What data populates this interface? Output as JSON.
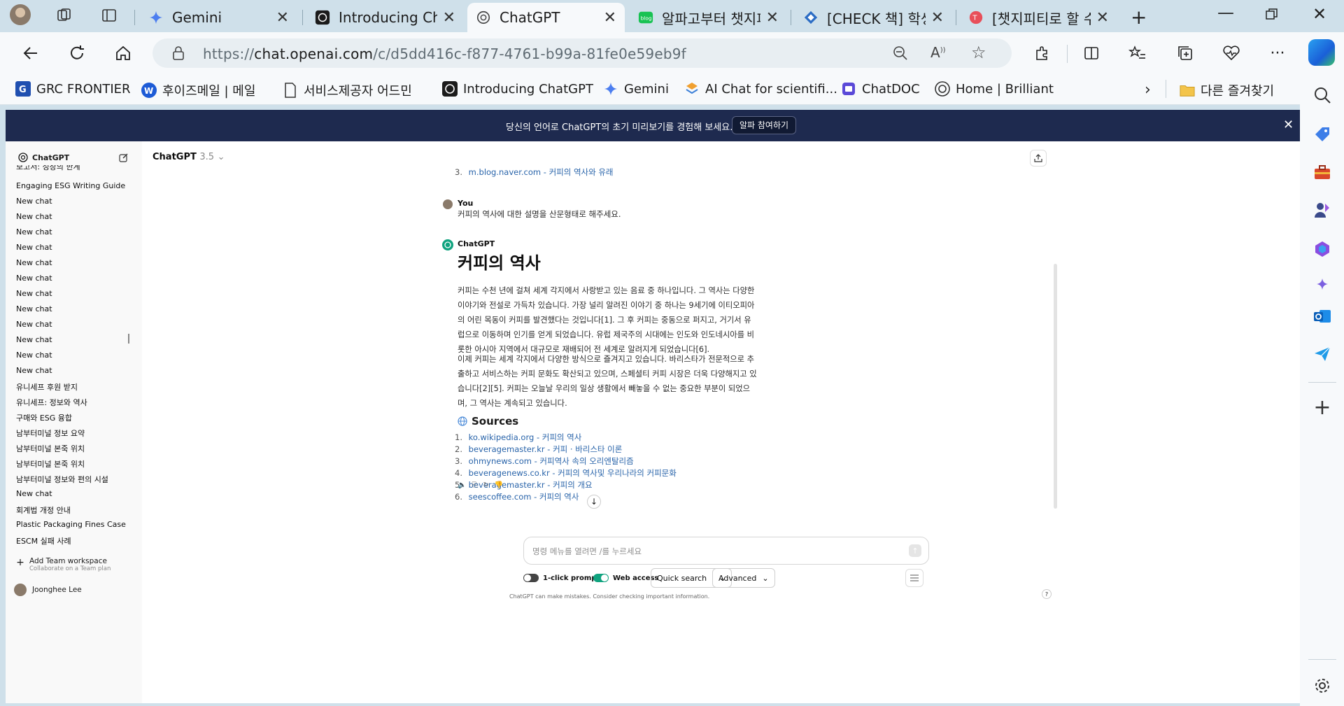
{
  "browser": {
    "tabs": [
      {
        "label": "Gemini",
        "active": false
      },
      {
        "label": "Introducing ChatGPT",
        "active": false
      },
      {
        "label": "ChatGPT",
        "active": true
      },
      {
        "label": "알파고부터 챗지피",
        "active": false
      },
      {
        "label": "[CHECK 책] 학생들",
        "active": false
      },
      {
        "label": "[챗지피티로 할 수",
        "active": false
      }
    ],
    "url_prefix": "https://",
    "url_host": "chat.openai.com",
    "url_path": "/c/d5dd416c-f877-4761-b99a-81fe0e59eb9f",
    "bookmarks": [
      {
        "label": "GRC FRONTIER",
        "icon": "grc-logo-icon"
      },
      {
        "label": "후이즈메일 | 메일",
        "icon": "whois-logo-icon"
      },
      {
        "label": "서비스제공자 어드민",
        "icon": "document-icon"
      },
      {
        "label": "Introducing ChatGPT",
        "icon": "chatgpt-logo-icon"
      },
      {
        "label": "Gemini",
        "icon": "gemini-icon"
      },
      {
        "label": "AI Chat for scientifi...",
        "icon": "scite-icon"
      },
      {
        "label": "ChatDOC",
        "icon": "chatdoc-icon"
      },
      {
        "label": "Home | Brilliant",
        "icon": "brilliant-icon"
      }
    ],
    "other_bookmarks": "다른 즐겨찾기"
  },
  "banner": {
    "text": "당신의 언어로 ChatGPT의 초기 미리보기를 경험해 보세요.",
    "button": "알파 참여하기"
  },
  "sidebar": {
    "title": "ChatGPT",
    "items": [
      "보고서: 성장의 한계",
      "Engaging ESG Writing Guide",
      "New chat",
      "New chat",
      "New chat",
      "New chat",
      "New chat",
      "New chat",
      "New chat",
      "New chat",
      "New chat",
      "New chat",
      "New chat",
      "New chat",
      "유니세프 후원 받지",
      "유니세프: 정보와 역사",
      "구매와 ESG 융합",
      "남부터미널 정보 요약",
      "남부터미널 본죽 위치",
      "남부터미널 본죽 위치",
      "남부터미널 정보와 편의 시설",
      "New chat",
      "회계법 개정 안내",
      "Plastic Packaging Fines Case",
      "ESCM 실패 사례"
    ],
    "team_title": "Add Team workspace",
    "team_sub": "Collaborate on a Team plan",
    "user": "Joonghee Lee"
  },
  "chat": {
    "model": "ChatGPT",
    "model_version": "3.5",
    "prev_source_num": "3.",
    "prev_source": "m.blog.naver.com - 커피의 역사와 유래",
    "user_name": "You",
    "user_msg": "커피의 역사에 대한 설명을 산문형태로 해주세요.",
    "bot_name": "ChatGPT",
    "heading": "커피의 역사",
    "para1": "커피는 수천 년에 걸쳐 세계 각지에서 사랑받고 있는 음료 중 하나입니다. 그 역사는 다양한 이야기와 전설로 가득차 있습니다. 가장 널리 알려진 이야기 중 하나는 9세기에 이티오피아의 어린 목동이 커피를 발견했다는 것입니다[1]. 그 후 커피는 중동으로 퍼지고, 거기서 유럽으로 이동하며 인기를 얻게 되었습니다. 유럽 제국주의 시대에는 인도와 인도네시아를 비롯한 아시아 지역에서 대규모로 재배되어 전 세계로 알려지게 되었습니다[6].",
    "para2": "이제 커피는 세계 각지에서 다양한 방식으로 즐겨지고 있습니다. 바리스타가 전문적으로 추출하고 서비스하는 커피 문화도 확산되고 있으며, 스페셜티 커피 시장은 더욱 다양해지고 있습니다[2][5]. 커피는 오늘날 우리의 일상 생활에서 빼놓을 수 없는 중요한 부분이 되었으며, 그 역사는 계속되고 있습니다.",
    "sources_title": "Sources",
    "sources": [
      {
        "num": "1.",
        "text": "ko.wikipedia.org - 커피의 역사"
      },
      {
        "num": "2.",
        "text": "beveragemaster.kr - 커피 · 바리스타 이론"
      },
      {
        "num": "3.",
        "text": "ohmynews.com - 커피역사 속의 오리엔탈리즘"
      },
      {
        "num": "4.",
        "text": "beveragenews.co.kr - 커피의 역사및 우리나라의 커피문화"
      },
      {
        "num": "5.",
        "text": "beveragemaster.kr - 커피의 개요"
      },
      {
        "num": "6.",
        "text": "seescoffee.com - 커피의 역사"
      }
    ],
    "input_placeholder": "명령 메뉴를 열려면 /를 누르세요",
    "oneclick": "1-click prompts",
    "web_access": "Web access",
    "quick_search": "Quick search",
    "advanced": "Advanced",
    "disclaimer": "ChatGPT can make mistakes. Consider checking important information."
  },
  "colors": {
    "banner_bg": "#1e2a4f",
    "link": "#2964aa",
    "toggle_on": "#10a37f",
    "chrome_bg": "#cfe0ea"
  }
}
